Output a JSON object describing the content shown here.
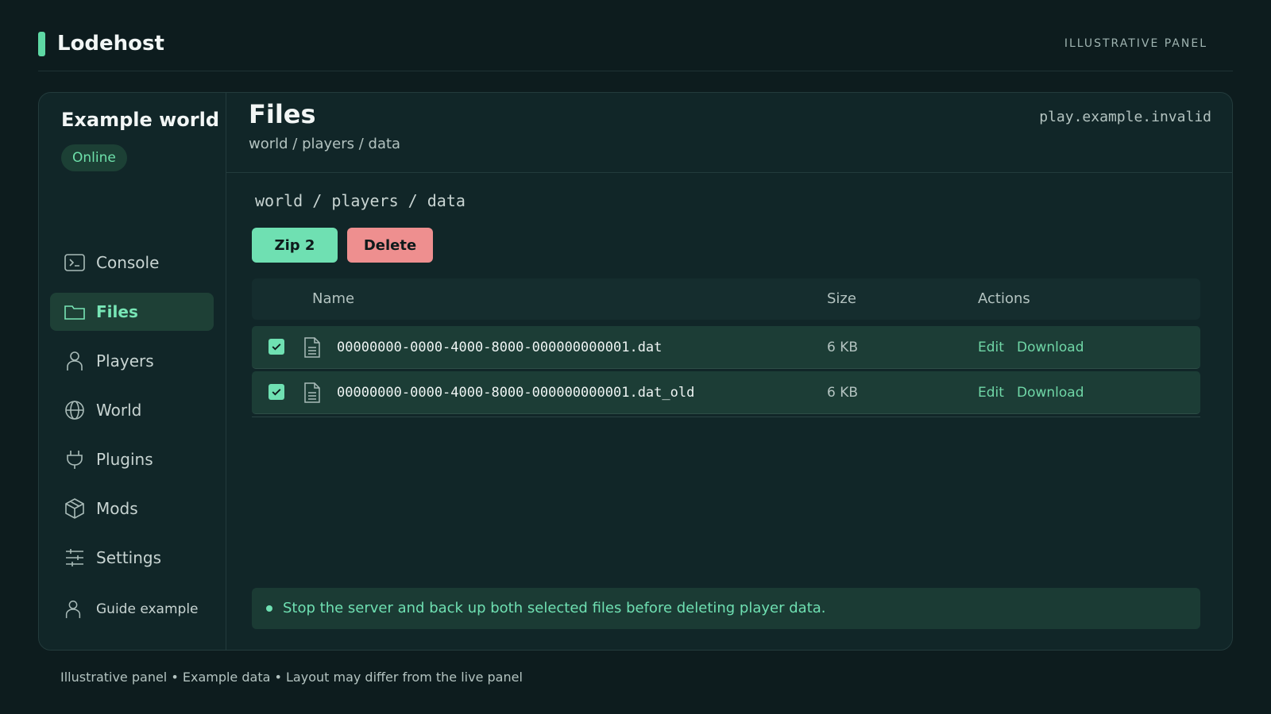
{
  "app": {
    "name": "Lodehost",
    "tag": "ILLUSTRATIVE PANEL"
  },
  "sidebar": {
    "world_name": "Example world",
    "status": "Online",
    "items": [
      {
        "label": "Console",
        "icon": "terminal-icon"
      },
      {
        "label": "Files",
        "icon": "folder-icon",
        "active": true
      },
      {
        "label": "Players",
        "icon": "user-icon"
      },
      {
        "label": "World",
        "icon": "globe-icon"
      },
      {
        "label": "Plugins",
        "icon": "plug-icon"
      },
      {
        "label": "Mods",
        "icon": "box-icon"
      },
      {
        "label": "Settings",
        "icon": "sliders-icon"
      }
    ],
    "user": {
      "label": "Guide example",
      "icon": "user-icon"
    }
  },
  "header": {
    "title": "Files",
    "breadcrumb": "world / players / data",
    "host": "play.example.invalid"
  },
  "main": {
    "path": "world / players / data",
    "buttons": {
      "zip": "Zip 2",
      "delete": "Delete"
    },
    "table": {
      "headers": {
        "name": "Name",
        "size": "Size",
        "actions": "Actions"
      },
      "rows": [
        {
          "name": "00000000-0000-4000-8000-000000000001.dat",
          "size": "6 KB",
          "checked": true,
          "edit": "Edit",
          "download": "Download"
        },
        {
          "name": "00000000-0000-4000-8000-000000000001.dat_old",
          "size": "6 KB",
          "checked": true,
          "edit": "Edit",
          "download": "Download"
        }
      ]
    },
    "notice": "Stop the server and back up both selected files before deleting player data."
  },
  "footer": "Illustrative panel • Example data • Layout may differ from the live panel",
  "colors": {
    "accent": "#6fe0b2",
    "danger": "#ee8f8f",
    "background": "#0d1c1e",
    "panel": "#112628"
  }
}
